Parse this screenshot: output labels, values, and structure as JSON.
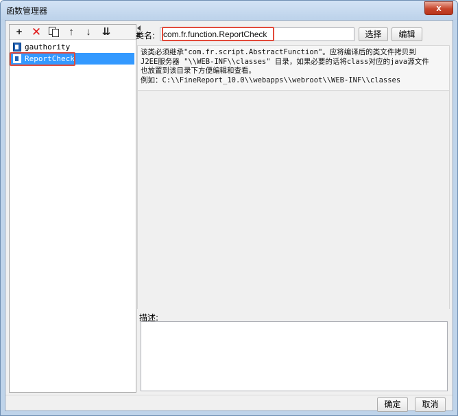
{
  "window": {
    "title": "函数管理器",
    "close_label": "x"
  },
  "toolbar": {
    "icons": [
      "add-icon",
      "delete-icon",
      "copy-icon",
      "move-up-icon",
      "move-down-icon",
      "sort-icon"
    ],
    "add_glyph": "+",
    "delete_glyph": "✕",
    "up_glyph": "↑",
    "down_glyph": "↓",
    "sort_glyph": "⇊"
  },
  "function_list": {
    "items": [
      {
        "label": "gauthority",
        "selected": false
      },
      {
        "label": "ReportCheck",
        "selected": true
      }
    ]
  },
  "class_field": {
    "label": "类名:",
    "value": "com.fr.function.ReportCheck"
  },
  "buttons": {
    "select_label": "选择",
    "edit_label": "编辑",
    "ok_label": "确定",
    "cancel_label": "取消"
  },
  "info": {
    "lines": [
      "该类必须继承\"com.fr.script.AbstractFunction\"。应将编译后的类文件拷贝到",
      "J2EE服务器 \"\\\\WEB-INF\\\\classes\" 目录，如果必要的话将class对应的java源文件",
      "也放置到该目录下方便编辑和查看。",
      "例如：C:\\\\FineReport_10.0\\\\webapps\\\\webroot\\\\WEB-INF\\\\classes"
    ]
  },
  "description": {
    "label": "描述:",
    "value": ""
  },
  "colors": {
    "selection": "#3399ff",
    "highlight_box": "#e24a3a",
    "close_button": "#c7452c"
  }
}
